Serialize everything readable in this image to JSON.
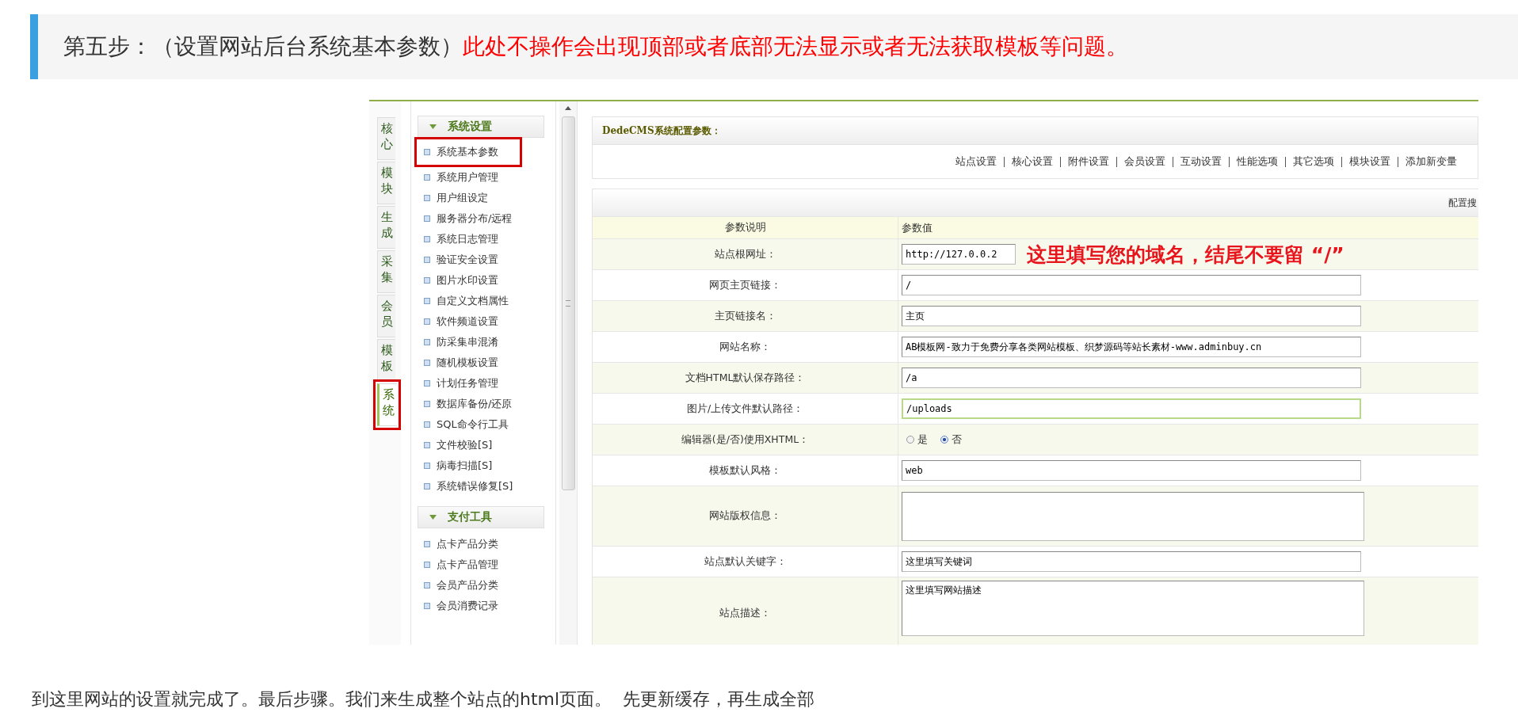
{
  "step_heading": {
    "prefix": "第五步：（设置网站后台系统基本参数）",
    "warning": "此处不操作会出现顶部或者底部无法显示或者无法获取模板等问题。"
  },
  "screenshot": {
    "side_tabs": [
      {
        "label": "核心",
        "selected": false,
        "boxed": false
      },
      {
        "label": "模块",
        "selected": false,
        "boxed": false
      },
      {
        "label": "生成",
        "selected": false,
        "boxed": false
      },
      {
        "label": "采集",
        "selected": false,
        "boxed": false
      },
      {
        "label": "会员",
        "selected": false,
        "boxed": false
      },
      {
        "label": "模板",
        "selected": false,
        "boxed": false
      },
      {
        "label": "系统",
        "selected": true,
        "boxed": true
      }
    ],
    "menu_sections": [
      {
        "title": "系统设置",
        "expanded": true,
        "items": [
          {
            "label": "系统基本参数",
            "boxed": true
          },
          {
            "label": "系统用户管理",
            "boxed": false
          },
          {
            "label": "用户组设定",
            "boxed": false
          },
          {
            "label": "服务器分布/远程",
            "boxed": false
          },
          {
            "label": "系统日志管理",
            "boxed": false
          },
          {
            "label": "验证安全设置",
            "boxed": false
          },
          {
            "label": "图片水印设置",
            "boxed": false
          },
          {
            "label": "自定义文档属性",
            "boxed": false
          },
          {
            "label": "软件频道设置",
            "boxed": false
          },
          {
            "label": "防采集串混淆",
            "boxed": false
          },
          {
            "label": "随机模板设置",
            "boxed": false
          },
          {
            "label": "计划任务管理",
            "boxed": false
          },
          {
            "label": "数据库备份/还原",
            "boxed": false
          },
          {
            "label": "SQL命令行工具",
            "boxed": false
          },
          {
            "label": "文件校验[S]",
            "boxed": false
          },
          {
            "label": "病毒扫描[S]",
            "boxed": false
          },
          {
            "label": "系统错误修复[S]",
            "boxed": false
          }
        ]
      },
      {
        "title": "支付工具",
        "expanded": true,
        "items": [
          {
            "label": "点卡产品分类",
            "boxed": false
          },
          {
            "label": "点卡产品管理",
            "boxed": false
          },
          {
            "label": "会员产品分类",
            "boxed": false
          },
          {
            "label": "会员消费记录",
            "boxed": false
          }
        ]
      }
    ],
    "panel_title": "DedeCMS系统配置参数：",
    "nav_links": [
      "站点设置",
      "核心设置",
      "附件设置",
      "会员设置",
      "互动设置",
      "性能选项",
      "其它选项",
      "模块设置",
      "添加新变量"
    ],
    "table_caption": "配置搜",
    "columns": [
      "参数说明",
      "参数值"
    ],
    "rows": [
      {
        "label": "站点根网址：",
        "kind": "text",
        "value": "http://127.0.0.2",
        "focused": false,
        "note": "这里填写您的域名，结尾不要留 “/”"
      },
      {
        "label": "网页主页链接：",
        "kind": "text",
        "value": "/",
        "focused": false
      },
      {
        "label": "主页链接名：",
        "kind": "text",
        "value": "主页",
        "focused": false
      },
      {
        "label": "网站名称：",
        "kind": "text",
        "value": "AB模板网-致力于免费分享各类网站模板、织梦源码等站长素材-www.adminbuy.cn",
        "focused": false
      },
      {
        "label": "文档HTML默认保存路径：",
        "kind": "text",
        "value": "/a",
        "focused": false
      },
      {
        "label": "图片/上传文件默认路径：",
        "kind": "text",
        "value": "/uploads",
        "focused": true
      },
      {
        "label": "编辑器(是/否)使用XHTML：",
        "kind": "radio",
        "options": [
          {
            "label": "是",
            "selected": false
          },
          {
            "label": "否",
            "selected": true
          }
        ]
      },
      {
        "label": "模板默认风格：",
        "kind": "text",
        "value": "web",
        "focused": false
      },
      {
        "label": "网站版权信息：",
        "kind": "textarea",
        "value": ""
      },
      {
        "label": "站点默认关键字：",
        "kind": "text",
        "value": "这里填写关键词",
        "focused": false
      },
      {
        "label": "站点描述：",
        "kind": "textarea",
        "value": "这里填写网站描述"
      }
    ]
  },
  "closing_text": "到这里网站的设置就完成了。最后步骤。我们来生成整个站点的html页面。  先更新缓存，再生成全部"
}
